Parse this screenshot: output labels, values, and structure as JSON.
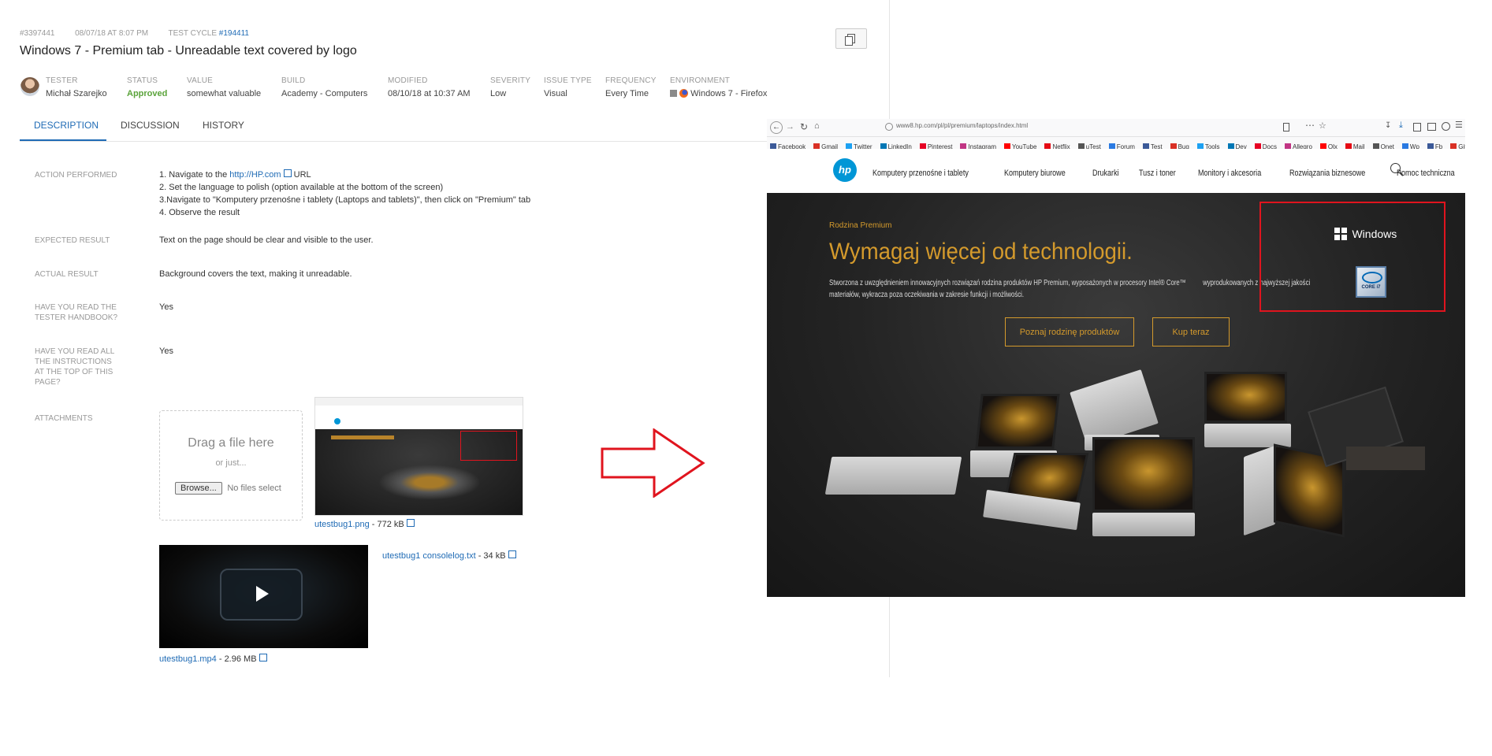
{
  "header": {
    "bug_id": "#3397441",
    "created": "08/07/18 AT 8:07 PM",
    "test_cycle_label": "TEST CYCLE",
    "test_cycle_link": "#194411",
    "title": "Windows 7 - Premium tab - Unreadable text covered by logo"
  },
  "meta": {
    "tester": {
      "label": "TESTER",
      "value": "Michał Szarejko"
    },
    "status": {
      "label": "STATUS",
      "value": "Approved"
    },
    "value": {
      "label": "VALUE",
      "value": "somewhat valuable"
    },
    "build": {
      "label": "BUILD",
      "value": "Academy - Computers"
    },
    "modified": {
      "label": "MODIFIED",
      "value": "08/10/18 at 10:37 AM"
    },
    "severity": {
      "label": "SEVERITY",
      "value": "Low"
    },
    "issue_type": {
      "label": "ISSUE TYPE",
      "value": "Visual"
    },
    "frequency": {
      "label": "FREQUENCY",
      "value": "Every Time"
    },
    "environment": {
      "label": "ENVIRONMENT",
      "value": "Windows 7 - Firefox"
    }
  },
  "tabs": [
    "DESCRIPTION",
    "DISCUSSION",
    "HISTORY"
  ],
  "sections": {
    "action": {
      "label": "ACTION PERFORMED",
      "step1_prefix": "1. Navigate to the",
      "step1_link": "http://HP.com",
      "step1_suffix": "URL",
      "step2": "2. Set the language to polish (option available at the bottom of the screen)",
      "step3": "3.Navigate to \"Komputery przenośne i tablety (Laptops and tablets)\", then click on \"Premium\" tab",
      "step4": "4. Observe the result"
    },
    "expected": {
      "label": "EXPECTED RESULT",
      "value": "Text on the page should be clear and visible to the user."
    },
    "actual": {
      "label": "ACTUAL RESULT",
      "value": "Background covers the text, making it unreadable."
    },
    "handbook": {
      "label": "HAVE YOU READ THE TESTER HANDBOOK?",
      "value": "Yes"
    },
    "instructions": {
      "label": "HAVE YOU READ ALL THE INSTRUCTIONS AT THE TOP OF THIS PAGE?",
      "value": "Yes"
    },
    "attachments": {
      "label": "ATTACHMENTS"
    }
  },
  "upload": {
    "drag_text": "Drag a file here",
    "or_text": "or just...",
    "browse_label": "Browse...",
    "no_files": "No files select"
  },
  "attachments": {
    "png_name": "utestbug1.png",
    "png_size": "- 772 kB",
    "log_name": "utestbug1 consolelog.txt",
    "log_size": "- 34 kB",
    "video_name": "utestbug1.mp4",
    "video_size": "- 2.96 MB"
  },
  "screenshot": {
    "url": "www8.hp.com/pl/pl/premium/laptops/index.html",
    "bookmarks": [
      "Facebook",
      "Gmail",
      "Twitter",
      "LinkedIn",
      "Pinterest",
      "Instagram",
      "YouTube",
      "Netflix",
      "uTest",
      "Forum",
      "Test",
      "Bug",
      "Tools",
      "Dev",
      "Docs",
      "Allegro",
      "Olx",
      "Mail",
      "Onet",
      "Wp",
      "Fb",
      "GitHub"
    ],
    "nav": [
      "Komputery przenośne i tablety",
      "Komputery biurowe",
      "Drukarki",
      "Tusz i toner",
      "Monitory i akcesoria",
      "Rozwiązania biznesowe",
      "Pomoc techniczna"
    ],
    "eyebrow": "Rodzina Premium",
    "headline": "Wymagaj więcej od technologii.",
    "body_line1": "Stworzona z uwzględnieniem innowacyjnych rozwiązań rodzina produktów HP Premium, wyposażonych w procesory Intel® Core™",
    "body_line1b": "wyprodukowanych z najwyższej jakości",
    "body_line2": "materiałów, wykracza poza oczekiwania w zakresie funkcji i możliwości.",
    "cta1": "Poznaj rodzinę produktów",
    "cta2": "Kup teraz",
    "windows_label": "Windows",
    "intel_label": "CORE i7"
  },
  "colors": {
    "link": "#1f6bb5",
    "approved": "#5aa33a",
    "highlight_box": "#e0141e",
    "arrow": "#e0141e",
    "hp_blue": "#0096d6",
    "gold": "#d49a2c"
  }
}
